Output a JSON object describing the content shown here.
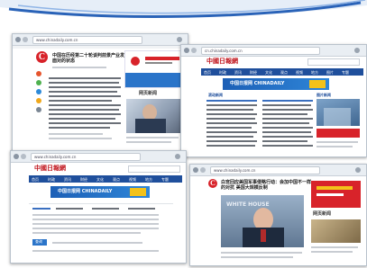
{
  "colors": {
    "brand_red": "#d8232a",
    "nav_blue": "#1f4f9c",
    "ad_blue": "#2a74c9",
    "accent_yellow": "#f3c21a"
  },
  "shot1": {
    "url": "www.chinadaily.com.cn",
    "logo_letter": "C",
    "headline": "中国在历经第二十轮谈判前景产业发展提高和面对的状态",
    "ad_banner": "中国日报网",
    "section_title": "网页新闻",
    "side_icons": [
      "share-weibo-icon",
      "share-wechat-icon",
      "share-qq-icon",
      "share-link-icon",
      "share-more-icon"
    ]
  },
  "shot2": {
    "url": "cn.chinadaily.com.cn",
    "site_name": "中國日報網",
    "nav_items": [
      "首页",
      "时政",
      "资讯",
      "财经",
      "文化",
      "观点",
      "视频",
      "地方",
      "图片",
      "专题"
    ],
    "ad_banner": "中国日报网 CHINADAILY",
    "section_left": "滚动新闻",
    "section_right": "图片新闻"
  },
  "shot3": {
    "url": "www.chinadaily.com.cn",
    "site_name": "中國日報網",
    "nav_items": [
      "首页",
      "时政",
      "资讯",
      "财经",
      "文化",
      "观点",
      "视频",
      "地方",
      "专题"
    ],
    "ad_banner": "中国日报网 CHINADAILY",
    "button_label": "查询"
  },
  "shot4": {
    "url": "www.chinadaily.com.cn",
    "logo_letter": "C",
    "headline": "白宫回应美国军事侵略行动：会加中国不一样的对抗 美国大规模反制",
    "section_title": "网页新闻",
    "photo_caption": "WHITE HOUSE"
  }
}
